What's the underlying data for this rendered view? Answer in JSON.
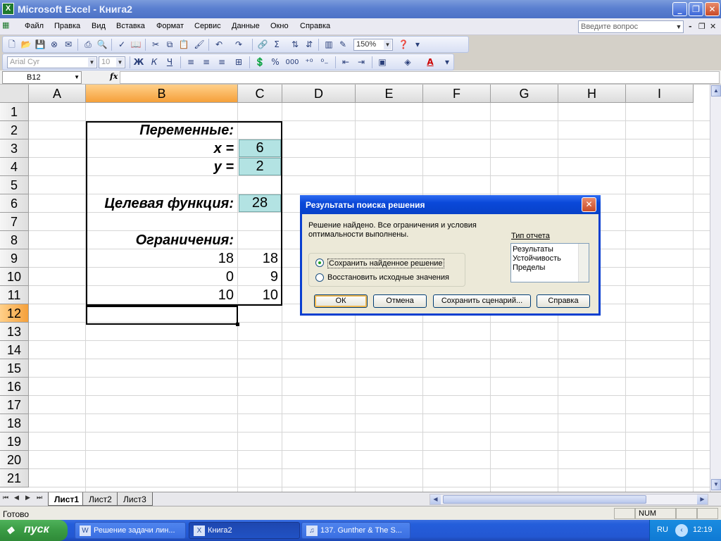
{
  "window": {
    "title": "Microsoft Excel - Книга2",
    "app_icon": "X",
    "minimize": "_",
    "restore": "❐",
    "close": "✕"
  },
  "menubar": {
    "items": [
      "Файл",
      "Правка",
      "Вид",
      "Вставка",
      "Формат",
      "Сервис",
      "Данные",
      "Окно",
      "Справка"
    ],
    "help_placeholder": "Введите вопрос",
    "doc_minimize": "-",
    "doc_restore": "❐",
    "doc_close": "✕"
  },
  "toolbar": {
    "zoom": "150%",
    "font_name": "Arial Cyr",
    "font_size": "10",
    "bold": "Ж",
    "italic": "К",
    "underline": "Ч",
    "percent": "%",
    "thousands": "000",
    "sigma": "Σ",
    "font_color_glyph": "A"
  },
  "formula_bar": {
    "name_box": "B12",
    "fx": "fx",
    "formula": ""
  },
  "columns": [
    "A",
    "B",
    "C",
    "D",
    "E",
    "F",
    "G",
    "H",
    "I"
  ],
  "active_column": "B",
  "active_row": "12",
  "rows": [
    "1",
    "2",
    "3",
    "4",
    "5",
    "6",
    "7",
    "8",
    "9",
    "10",
    "11",
    "12",
    "13",
    "14",
    "15",
    "16",
    "17",
    "18",
    "19",
    "20",
    "21"
  ],
  "cells": {
    "B2": "Переменные:",
    "B3": "x =",
    "C3": "6",
    "B4": "y =",
    "C4": "2",
    "B6": "Целевая функция:",
    "C6": "28",
    "B8": "Ограничения:",
    "B9": "18",
    "C9": "18",
    "B10": "0",
    "C10": "9",
    "B11": "10",
    "C11": "10"
  },
  "sheets": {
    "tabs": [
      "Лист1",
      "Лист2",
      "Лист3"
    ],
    "active": "Лист1"
  },
  "status": {
    "text": "Готово",
    "num": "NUM"
  },
  "taskbar": {
    "start": "пуск",
    "items": [
      "Решение задачи лин...",
      "Книга2",
      "137. Gunther & The S..."
    ],
    "lang": "RU",
    "clock": "12:19"
  },
  "dialog": {
    "title": "Результаты поиска решения",
    "message": "Решение найдено. Все ограничения и условия оптимальности выполнены.",
    "options": [
      "Сохранить найденное решение",
      "Восстановить исходные значения"
    ],
    "selected_option": 0,
    "report_type_label": "Тип отчета",
    "reports": [
      "Результаты",
      "Устойчивость",
      "Пределы"
    ],
    "buttons": {
      "ok": "ОК",
      "cancel": "Отмена",
      "save_scenario": "Сохранить сценарий...",
      "help": "Справка"
    }
  },
  "colors": {
    "cell_highlight": "#b3e3e3",
    "active_header": "#f5a03a",
    "title_bar": "#0a48d9"
  }
}
